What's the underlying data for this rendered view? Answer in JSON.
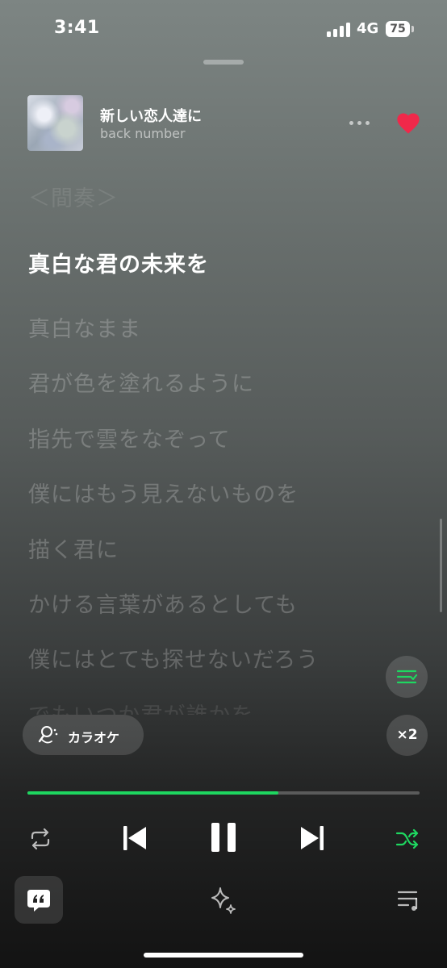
{
  "status_bar": {
    "time": "3:41",
    "network": "4G",
    "battery": "75"
  },
  "now_playing": {
    "title": "新しい恋人達に",
    "artist": "back number",
    "liked": true
  },
  "lyrics": [
    {
      "text": "＜間奏＞",
      "state": "fade"
    },
    {
      "text": "真白な君の未来を",
      "state": "active"
    },
    {
      "text": "真白なまま",
      "state": "inactive"
    },
    {
      "text": "君が色を塗れるように",
      "state": "inactive"
    },
    {
      "text": "指先で雲をなぞって",
      "state": "inactive"
    },
    {
      "text": "僕にはもう見えないものを",
      "state": "inactive"
    },
    {
      "text": "描く君に",
      "state": "inactive"
    },
    {
      "text": "かける言葉があるとしても",
      "state": "inactive"
    },
    {
      "text": "僕にはとても探せないだろう",
      "state": "inactive"
    },
    {
      "text": "でもいつか君が誰かを",
      "state": "fade"
    }
  ],
  "karaoke": {
    "label": "カラオケ"
  },
  "speed": {
    "label": "×2"
  },
  "playback": {
    "progress": 0.64
  },
  "colors": {
    "accent": "#1ed760",
    "heart": "#f0284a"
  }
}
